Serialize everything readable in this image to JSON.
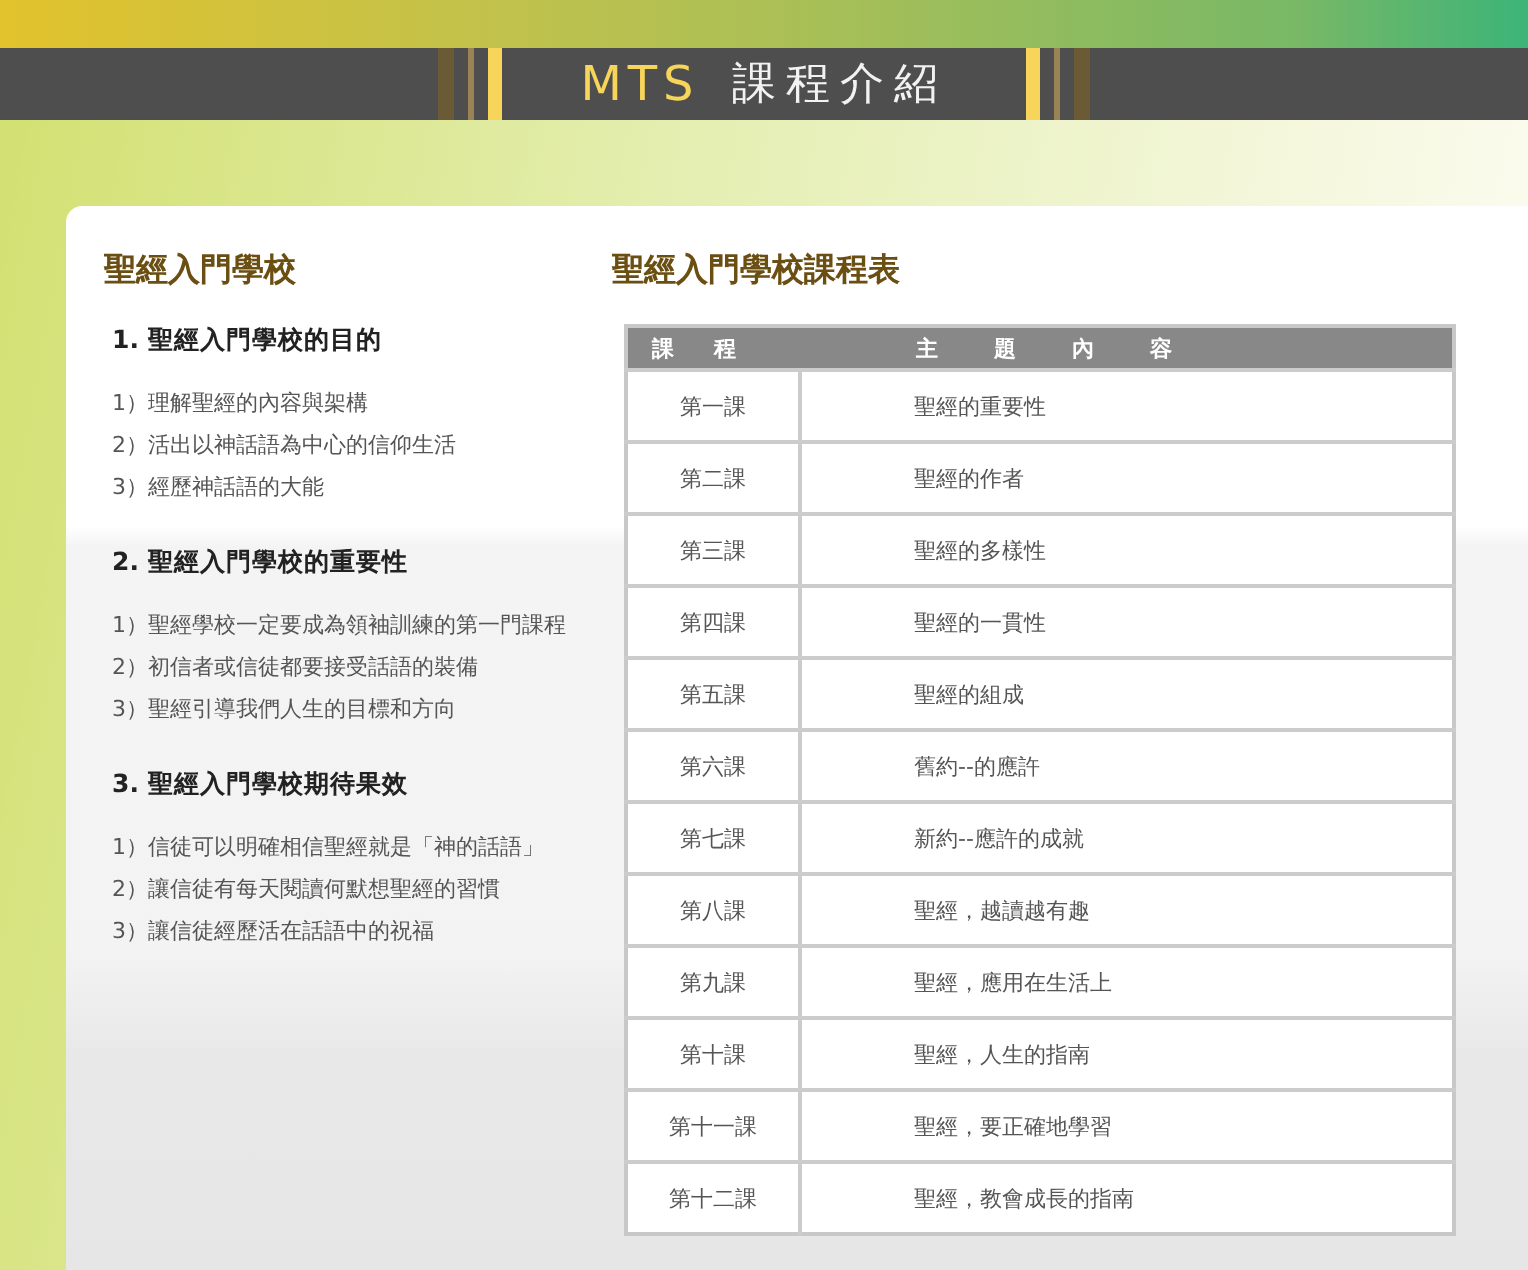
{
  "header": {
    "brand": "MTS",
    "title": "課程介紹"
  },
  "intro": {
    "title": "聖經入門學校",
    "sections": [
      {
        "heading": "1. 聖經入門學校的目的",
        "items": [
          "1）理解聖經的內容與架構",
          "2）活出以神話語為中心的信仰生活",
          "3）經歷神話語的大能"
        ]
      },
      {
        "heading": "2. 聖經入門學校的重要性",
        "items": [
          "1）聖經學校一定要成為領袖訓練的第一門課程",
          "2）初信者或信徒都要接受話語的裝備",
          "3）聖經引導我們人生的目標和方向"
        ]
      },
      {
        "heading": "3. 聖經入門學校期待果效",
        "items": [
          "1）信徒可以明確相信聖經就是「神的話語」",
          "2）讓信徒有每天閱讀何默想聖經的習慣",
          "3）讓信徒經歷活在話語中的祝福"
        ]
      }
    ]
  },
  "schedule": {
    "title": "聖經入門學校課程表",
    "columns": [
      "課程",
      "主題內容"
    ],
    "rows": [
      [
        "第一課",
        "聖經的重要性"
      ],
      [
        "第二課",
        "聖經的作者"
      ],
      [
        "第三課",
        "聖經的多樣性"
      ],
      [
        "第四課",
        "聖經的一貫性"
      ],
      [
        "第五課",
        "聖經的組成"
      ],
      [
        "第六課",
        "舊約--的應許"
      ],
      [
        "第七課",
        "新約--應許的成就"
      ],
      [
        "第八課",
        "聖經，越讀越有趣"
      ],
      [
        "第九課",
        "聖經，應用在生活上"
      ],
      [
        "第十課",
        "聖經，人生的指南"
      ],
      [
        "第十一課",
        "聖經，要正確地學習"
      ],
      [
        "第十二課",
        "聖經，教會成長的指南"
      ]
    ]
  }
}
